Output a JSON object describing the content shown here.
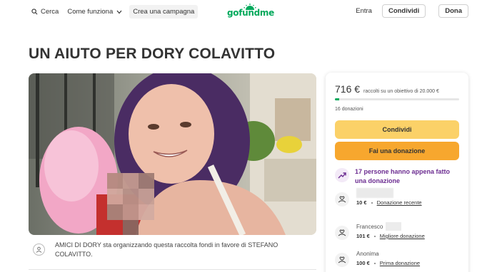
{
  "header": {
    "search_label": "Cerca",
    "how_it_works_label": "Come funziona",
    "create_campaign_label": "Crea una campagna",
    "logo_text": "gofundme",
    "login_label": "Entra",
    "share_label": "Condividi",
    "donate_label": "Dona"
  },
  "campaign": {
    "title": "UN AIUTO PER DORY COLAVITTO",
    "organizer_text": "AMICI DI DORY sta organizzando questa raccolta fondi in favore di STEFANO COLAVITTO."
  },
  "card": {
    "amount": "716 €",
    "goal_text": "raccolti su un obiettivo di 20.000 €",
    "progress_fraction": 0.0358,
    "donation_count": "16 donazioni",
    "share_button": "Condividi",
    "donate_button": "Fai una donazione",
    "recent_notice": "17 persone hanno appena fatto una donazione",
    "donors": [
      {
        "name": "",
        "amount": "10 €",
        "tag": "Donazione recente"
      },
      {
        "name": "Francesco",
        "amount": "101 €",
        "tag": "Migliore donazione"
      },
      {
        "name": "Anonima",
        "amount": "100 €",
        "tag": "Prima donazione"
      }
    ]
  },
  "colors": {
    "brand_green": "#02a95c",
    "share_yellow": "#fbd168",
    "donate_orange": "#f7a72e",
    "accent_purple": "#6c2d91"
  }
}
